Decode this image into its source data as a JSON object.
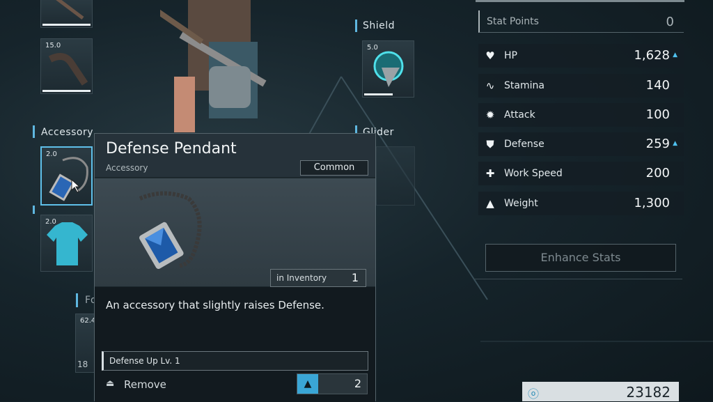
{
  "equipment": {
    "slot_top_weight": "",
    "slot_axe_weight": "15.0",
    "accessory_label": "Accessory",
    "accessory_weight": "2.0",
    "shirt_weight": "2.0",
    "food_label": "Food",
    "food_weight": "62.4",
    "food_count": "18",
    "shield_label": "Shield",
    "shield_weight": "5.0",
    "glider_label": "Glider"
  },
  "stats": {
    "stat_points_label": "Stat Points",
    "stat_points_value": "0",
    "rows": [
      {
        "icon": "heart-icon",
        "label": "HP",
        "value": "1,628",
        "boosted": true
      },
      {
        "icon": "pulse-icon",
        "label": "Stamina",
        "value": "140",
        "boosted": false
      },
      {
        "icon": "burst-icon",
        "label": "Attack",
        "value": "100",
        "boosted": false
      },
      {
        "icon": "shield-icon",
        "label": "Defense",
        "value": "259",
        "boosted": true
      },
      {
        "icon": "work-icon",
        "label": "Work Speed",
        "value": "200",
        "boosted": false
      },
      {
        "icon": "weight-icon",
        "label": "Weight",
        "value": "1,300",
        "boosted": false
      }
    ],
    "enhance_label": "Enhance Stats",
    "currency_value": "23182"
  },
  "tooltip": {
    "title": "Defense Pendant",
    "category": "Accessory",
    "rarity": "Common",
    "inventory_label": "in Inventory",
    "inventory_count": "1",
    "description": "An accessory that slightly raises Defense.",
    "passive": "Defense Up Lv. 1",
    "remove_label": "Remove",
    "weight_count": "2"
  },
  "colors": {
    "accent": "#4fc1ef",
    "panel": "#1c272d"
  }
}
